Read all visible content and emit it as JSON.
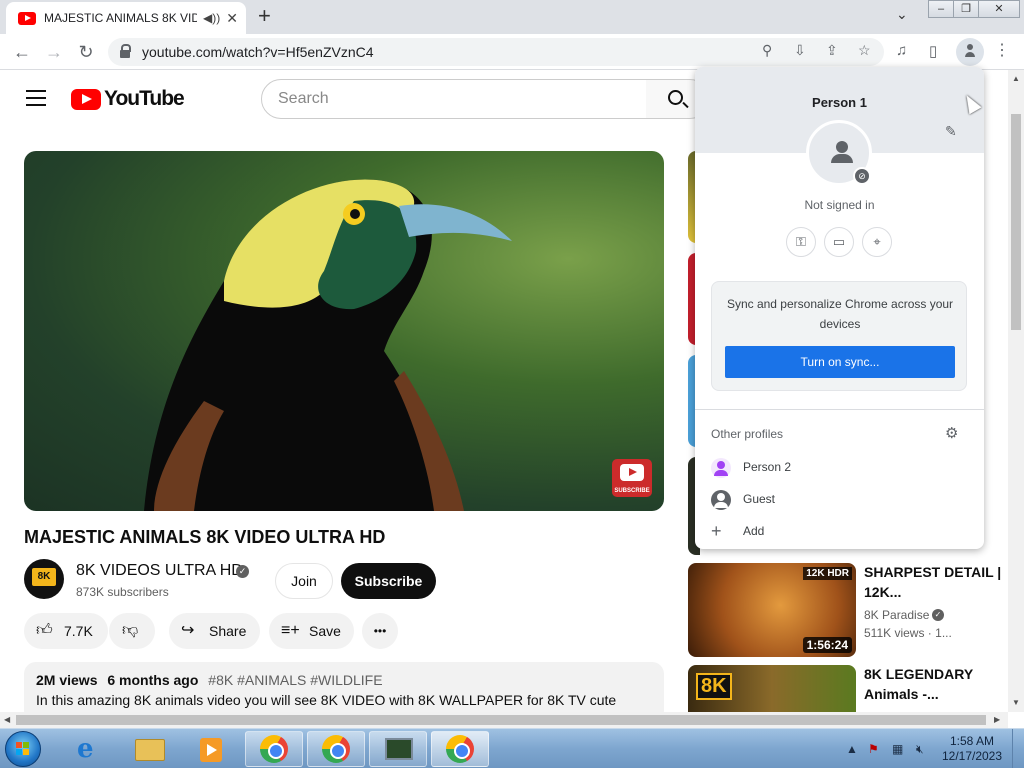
{
  "browser": {
    "tab_title": "MAJESTIC ANIMALS 8K VIDE",
    "tab_audio_icon": "speaker-icon",
    "tab_close": "✕",
    "new_tab": "+",
    "tab_search": "⌄",
    "url": "youtube.com/watch?v=Hf5enZVznC4",
    "window_controls": [
      "–",
      "❐",
      "✕"
    ]
  },
  "youtube": {
    "logo_text": "YouTube",
    "search_placeholder": "Search"
  },
  "video": {
    "title": "MAJESTIC ANIMALS 8K VIDEO ULTRA HD",
    "watermark_text": "SUBSCRIBE",
    "channel_name": "8K VIDEOS ULTRA HD",
    "channel_badge": "8K",
    "subscribers": "873K subscribers",
    "join_label": "Join",
    "subscribe_label": "Subscribe",
    "like_count": "7.7K",
    "share_label": "Share",
    "save_label": "Save",
    "more_label": "•••",
    "views": "2M views",
    "age": "6 months ago",
    "hashtags": "#8K #ANIMALS #WILDLIFE",
    "description": "In this amazing 8K animals video you will see 8K VIDEO with 8K WALLPAPER for 8K TV cute"
  },
  "recommendations": [
    {
      "duration": "1:56:24",
      "badge": "12K HDR",
      "title": "SHARPEST DETAIL | 12K...",
      "channel": "8K Paradise",
      "meta": "511K views · 1..."
    },
    {
      "badge": "8K",
      "title": "8K LEGENDARY Animals -..."
    }
  ],
  "profile_menu": {
    "name": "Person 1",
    "status": "Not signed in",
    "sync_text": "Sync and personalize Chrome across your devices",
    "sync_button": "Turn on sync...",
    "other_profiles_label": "Other profiles",
    "profiles": [
      {
        "label": "Person 2",
        "color": "#a142f4"
      },
      {
        "label": "Guest",
        "color": "#5f6368"
      },
      {
        "label": "Add",
        "color": "#5f6368"
      }
    ]
  },
  "taskbar": {
    "time": "1:58 AM",
    "date": "12/17/2023"
  },
  "colors": {
    "youtube_red": "#ff0000",
    "chrome_blue": "#1a73e8",
    "taskbar": "#7ea6cf"
  }
}
